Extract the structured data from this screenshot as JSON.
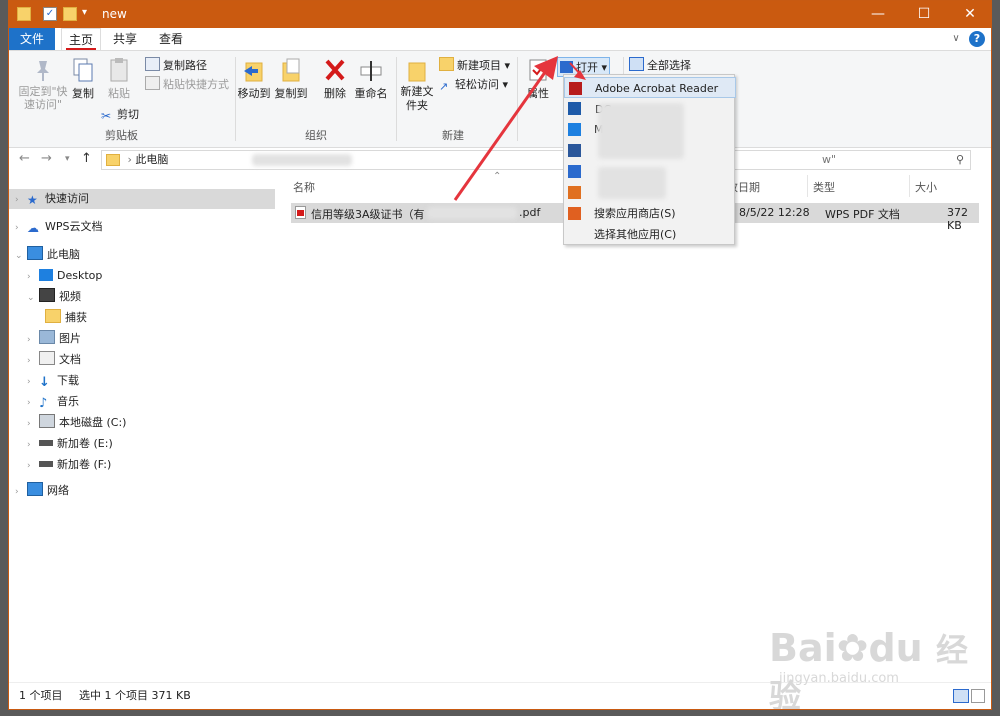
{
  "window": {
    "title": "new",
    "minimize": "—",
    "maximize": "☐",
    "close": "✕"
  },
  "tabs": {
    "file": "文件",
    "home": "主页",
    "share": "共享",
    "view": "查看",
    "expand": "∨",
    "help": "?"
  },
  "ribbon": {
    "pin_quick": "固定到\"快速访问\"",
    "copy": "复制",
    "paste": "粘贴",
    "copy_path": "复制路径",
    "paste_shortcut": "粘贴快捷方式",
    "cut": "剪切",
    "group_clipboard": "剪贴板",
    "move_to": "移动到",
    "copy_to": "复制到",
    "delete": "删除",
    "rename": "重命名",
    "group_organize": "组织",
    "new_folder": "新建文件夹",
    "new_item": "新建项目",
    "easy_access": "轻松访问",
    "group_new": "新建",
    "properties": "属性",
    "open": "打开",
    "select_all": "全部选择"
  },
  "address": {
    "path": "此电脑",
    "search": "w\""
  },
  "sidebar": {
    "quick_access": "快速访问",
    "wps_cloud": "WPS云文档",
    "this_pc": "此电脑",
    "desktop": "Desktop",
    "videos": "视频",
    "capture": "捕获",
    "pictures": "图片",
    "documents": "文档",
    "downloads": "下载",
    "music": "音乐",
    "local_c": "本地磁盘 (C:)",
    "vol_e": "新加卷 (E:)",
    "vol_f": "新加卷 (F:)",
    "network": "网络"
  },
  "columns": {
    "name": "名称",
    "date": "改日期",
    "type": "类型",
    "size": "大小"
  },
  "file_row": {
    "name_start": "信用等级3A级证书（有",
    "name_ext": ".pdf",
    "date": "8/5/22 12:28",
    "type": "WPS PDF 文档",
    "size": "372 KB"
  },
  "open_menu": {
    "items": [
      "Adobe Acrobat Reader DC",
      "M",
      "",
      "5",
      "",
      ""
    ],
    "store": "搜索应用商店(S)",
    "other": "选择其他应用(C)"
  },
  "status": {
    "count": "1 个项目",
    "selected": "选中 1 个项目  371 KB"
  },
  "watermark": {
    "brand": "Bai",
    "brand2": "du",
    "cn": "经验",
    "url": "jingyan.baidu.com"
  },
  "colors": {
    "titlebar": "#ca5a10",
    "file_tab": "#1e72c9",
    "arrow": "#e5353d"
  }
}
